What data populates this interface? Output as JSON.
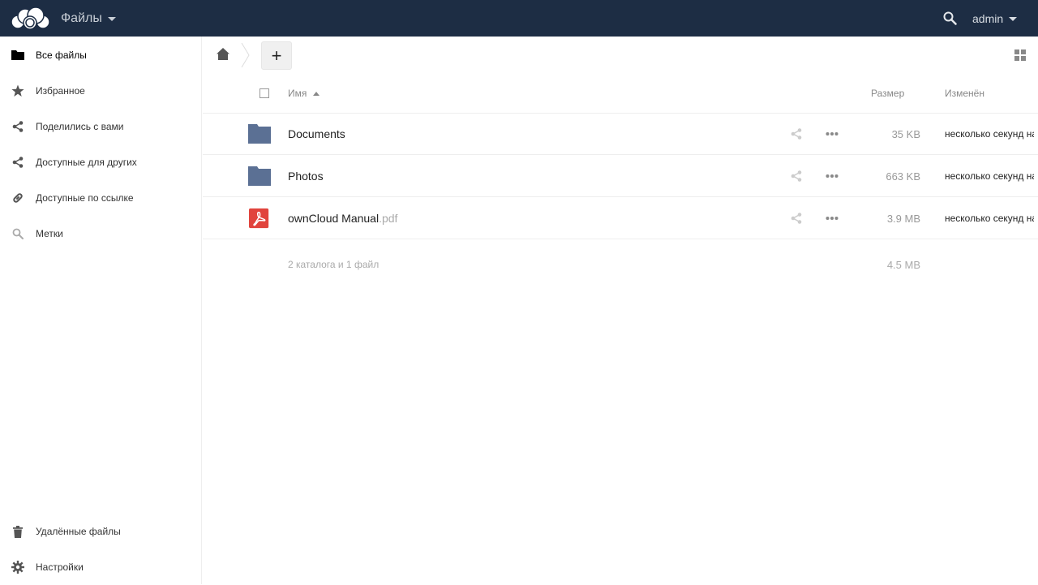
{
  "header": {
    "app_name": "Файлы",
    "user_name": "admin",
    "logo_icon": "owncloud-logo-icon",
    "colors": {
      "background": "#1d2d44",
      "text": "#c8ced6"
    }
  },
  "sidebar": {
    "items": [
      {
        "label": "Все файлы",
        "icon": "folder-icon",
        "active": true
      },
      {
        "label": "Избранное",
        "icon": "star-icon"
      },
      {
        "label": "Поделились с вами",
        "icon": "share-icon"
      },
      {
        "label": "Доступные для других",
        "icon": "share-icon"
      },
      {
        "label": "Доступные по ссылке",
        "icon": "link-icon"
      },
      {
        "label": "Метки",
        "icon": "search-icon"
      }
    ],
    "bottom_items": [
      {
        "label": "Удалённые файлы",
        "icon": "trash-icon"
      },
      {
        "label": "Настройки",
        "icon": "gear-icon"
      }
    ]
  },
  "controls": {
    "new_label": "+"
  },
  "table": {
    "headers": {
      "name": "Имя",
      "size": "Размер",
      "modified": "Изменён"
    },
    "rows": [
      {
        "name": "Documents",
        "ext": "",
        "type": "folder",
        "size": "35 KB",
        "modified": "несколько секунд назад"
      },
      {
        "name": "Photos",
        "ext": "",
        "type": "folder",
        "size": "663 KB",
        "modified": "несколько секунд назад"
      },
      {
        "name": "ownCloud Manual",
        "ext": ".pdf",
        "type": "pdf",
        "size": "3.9 MB",
        "modified": "несколько секунд назад"
      }
    ],
    "summary": {
      "text": "2 каталога и 1 файл",
      "size": "4.5 MB"
    }
  },
  "colors": {
    "folder": "#5b7094",
    "pdf": "#e1443d"
  }
}
